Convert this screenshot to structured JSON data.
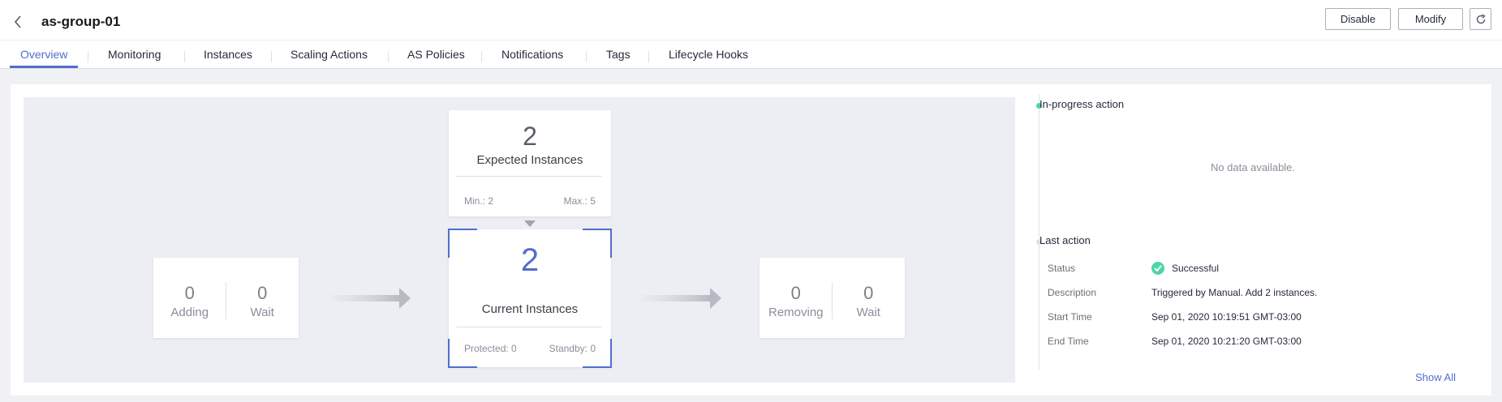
{
  "header": {
    "title": "as-group-01",
    "buttons": {
      "disable": "Disable",
      "modify": "Modify"
    }
  },
  "tabs": [
    {
      "label": "Overview",
      "active": true
    },
    {
      "label": "Monitoring"
    },
    {
      "label": "Instances"
    },
    {
      "label": "Scaling Actions"
    },
    {
      "label": "AS Policies"
    },
    {
      "label": "Notifications"
    },
    {
      "label": "Tags"
    },
    {
      "label": "Lifecycle Hooks"
    }
  ],
  "diagram": {
    "adding": {
      "value": "0",
      "label": "Adding",
      "wait_value": "0",
      "wait_label": "Wait"
    },
    "expected": {
      "value": "2",
      "label": "Expected Instances",
      "min": "Min.: 2",
      "max": "Max.: 5"
    },
    "current": {
      "value": "2",
      "label": "Current Instances",
      "protected": "Protected: 0",
      "standby": "Standby: 0"
    },
    "removing": {
      "value": "0",
      "label": "Removing",
      "wait_value": "0",
      "wait_label": "Wait"
    }
  },
  "panel": {
    "in_progress_title": "In-progress action",
    "no_data": "No data available.",
    "last_action_title": "Last action",
    "rows": [
      {
        "label": "Status",
        "value": "Successful"
      },
      {
        "label": "Description",
        "value": "Triggered by Manual. Add 2 instances."
      },
      {
        "label": "Start Time",
        "value": "Sep 01, 2020 10:19:51 GMT-03:00"
      },
      {
        "label": "End Time",
        "value": "Sep 01, 2020 10:21:20 GMT-03:00"
      }
    ],
    "show_all": "Show All"
  },
  "colors": {
    "accent": "#526ecc",
    "success": "#50d4ab",
    "diagram_bg": "#eceef4"
  }
}
